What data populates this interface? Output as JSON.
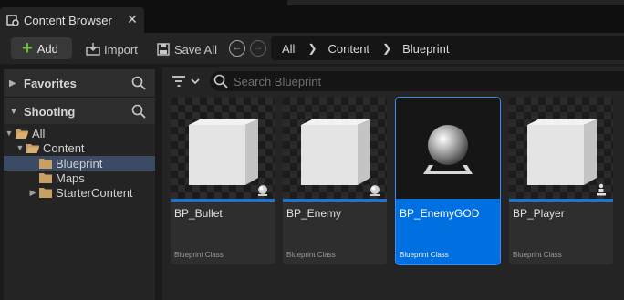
{
  "tab": {
    "title": "Content Browser",
    "close": "✕"
  },
  "toolbar": {
    "add_label": "Add",
    "import_label": "Import",
    "save_all_label": "Save All",
    "breadcrumb": [
      "All",
      "Content",
      "Blueprint"
    ]
  },
  "sidebar": {
    "favorites_label": "Favorites",
    "project_label": "Shooting",
    "tree": [
      {
        "label": "All",
        "expanded": true,
        "selected": false
      },
      {
        "label": "Content",
        "expanded": true,
        "selected": false
      },
      {
        "label": "Blueprint",
        "expanded": false,
        "selected": true
      },
      {
        "label": "Maps",
        "expanded": false,
        "selected": false
      },
      {
        "label": "StarterContent",
        "expanded": false,
        "selected": false
      }
    ]
  },
  "search": {
    "placeholder": "Search Blueprint"
  },
  "assets": [
    {
      "name": "BP_Bullet",
      "type": "Blueprint Class",
      "thumb": "cube",
      "badge": "pawn-icon",
      "selected": false
    },
    {
      "name": "BP_Enemy",
      "type": "Blueprint Class",
      "thumb": "cube",
      "badge": "pawn-icon",
      "selected": false
    },
    {
      "name": "BP_EnemyGOD",
      "type": "Blueprint Class",
      "thumb": "sphere",
      "badge": "",
      "selected": true
    },
    {
      "name": "BP_Player",
      "type": "Blueprint Class",
      "thumb": "cube",
      "badge": "character-icon",
      "selected": false
    }
  ],
  "colors": {
    "accent": "#0070e0",
    "add_green": "#6cbf3b",
    "folder": "#c9a063",
    "selection_row": "#3b4b66"
  }
}
